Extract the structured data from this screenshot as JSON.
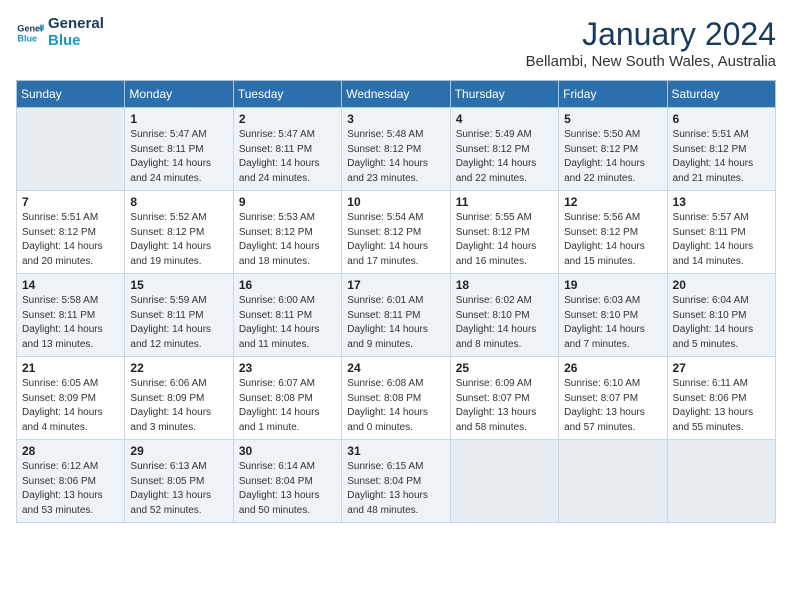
{
  "logo": {
    "line1": "General",
    "line2": "Blue"
  },
  "title": "January 2024",
  "subtitle": "Bellambi, New South Wales, Australia",
  "days_header": [
    "Sunday",
    "Monday",
    "Tuesday",
    "Wednesday",
    "Thursday",
    "Friday",
    "Saturday"
  ],
  "weeks": [
    [
      {
        "day": "",
        "info": ""
      },
      {
        "day": "1",
        "info": "Sunrise: 5:47 AM\nSunset: 8:11 PM\nDaylight: 14 hours\nand 24 minutes."
      },
      {
        "day": "2",
        "info": "Sunrise: 5:47 AM\nSunset: 8:11 PM\nDaylight: 14 hours\nand 24 minutes."
      },
      {
        "day": "3",
        "info": "Sunrise: 5:48 AM\nSunset: 8:12 PM\nDaylight: 14 hours\nand 23 minutes."
      },
      {
        "day": "4",
        "info": "Sunrise: 5:49 AM\nSunset: 8:12 PM\nDaylight: 14 hours\nand 22 minutes."
      },
      {
        "day": "5",
        "info": "Sunrise: 5:50 AM\nSunset: 8:12 PM\nDaylight: 14 hours\nand 22 minutes."
      },
      {
        "day": "6",
        "info": "Sunrise: 5:51 AM\nSunset: 8:12 PM\nDaylight: 14 hours\nand 21 minutes."
      }
    ],
    [
      {
        "day": "7",
        "info": "Sunrise: 5:51 AM\nSunset: 8:12 PM\nDaylight: 14 hours\nand 20 minutes."
      },
      {
        "day": "8",
        "info": "Sunrise: 5:52 AM\nSunset: 8:12 PM\nDaylight: 14 hours\nand 19 minutes."
      },
      {
        "day": "9",
        "info": "Sunrise: 5:53 AM\nSunset: 8:12 PM\nDaylight: 14 hours\nand 18 minutes."
      },
      {
        "day": "10",
        "info": "Sunrise: 5:54 AM\nSunset: 8:12 PM\nDaylight: 14 hours\nand 17 minutes."
      },
      {
        "day": "11",
        "info": "Sunrise: 5:55 AM\nSunset: 8:12 PM\nDaylight: 14 hours\nand 16 minutes."
      },
      {
        "day": "12",
        "info": "Sunrise: 5:56 AM\nSunset: 8:12 PM\nDaylight: 14 hours\nand 15 minutes."
      },
      {
        "day": "13",
        "info": "Sunrise: 5:57 AM\nSunset: 8:11 PM\nDaylight: 14 hours\nand 14 minutes."
      }
    ],
    [
      {
        "day": "14",
        "info": "Sunrise: 5:58 AM\nSunset: 8:11 PM\nDaylight: 14 hours\nand 13 minutes."
      },
      {
        "day": "15",
        "info": "Sunrise: 5:59 AM\nSunset: 8:11 PM\nDaylight: 14 hours\nand 12 minutes."
      },
      {
        "day": "16",
        "info": "Sunrise: 6:00 AM\nSunset: 8:11 PM\nDaylight: 14 hours\nand 11 minutes."
      },
      {
        "day": "17",
        "info": "Sunrise: 6:01 AM\nSunset: 8:11 PM\nDaylight: 14 hours\nand 9 minutes."
      },
      {
        "day": "18",
        "info": "Sunrise: 6:02 AM\nSunset: 8:10 PM\nDaylight: 14 hours\nand 8 minutes."
      },
      {
        "day": "19",
        "info": "Sunrise: 6:03 AM\nSunset: 8:10 PM\nDaylight: 14 hours\nand 7 minutes."
      },
      {
        "day": "20",
        "info": "Sunrise: 6:04 AM\nSunset: 8:10 PM\nDaylight: 14 hours\nand 5 minutes."
      }
    ],
    [
      {
        "day": "21",
        "info": "Sunrise: 6:05 AM\nSunset: 8:09 PM\nDaylight: 14 hours\nand 4 minutes."
      },
      {
        "day": "22",
        "info": "Sunrise: 6:06 AM\nSunset: 8:09 PM\nDaylight: 14 hours\nand 3 minutes."
      },
      {
        "day": "23",
        "info": "Sunrise: 6:07 AM\nSunset: 8:08 PM\nDaylight: 14 hours\nand 1 minute."
      },
      {
        "day": "24",
        "info": "Sunrise: 6:08 AM\nSunset: 8:08 PM\nDaylight: 14 hours\nand 0 minutes."
      },
      {
        "day": "25",
        "info": "Sunrise: 6:09 AM\nSunset: 8:07 PM\nDaylight: 13 hours\nand 58 minutes."
      },
      {
        "day": "26",
        "info": "Sunrise: 6:10 AM\nSunset: 8:07 PM\nDaylight: 13 hours\nand 57 minutes."
      },
      {
        "day": "27",
        "info": "Sunrise: 6:11 AM\nSunset: 8:06 PM\nDaylight: 13 hours\nand 55 minutes."
      }
    ],
    [
      {
        "day": "28",
        "info": "Sunrise: 6:12 AM\nSunset: 8:06 PM\nDaylight: 13 hours\nand 53 minutes."
      },
      {
        "day": "29",
        "info": "Sunrise: 6:13 AM\nSunset: 8:05 PM\nDaylight: 13 hours\nand 52 minutes."
      },
      {
        "day": "30",
        "info": "Sunrise: 6:14 AM\nSunset: 8:04 PM\nDaylight: 13 hours\nand 50 minutes."
      },
      {
        "day": "31",
        "info": "Sunrise: 6:15 AM\nSunset: 8:04 PM\nDaylight: 13 hours\nand 48 minutes."
      },
      {
        "day": "",
        "info": ""
      },
      {
        "day": "",
        "info": ""
      },
      {
        "day": "",
        "info": ""
      }
    ]
  ]
}
